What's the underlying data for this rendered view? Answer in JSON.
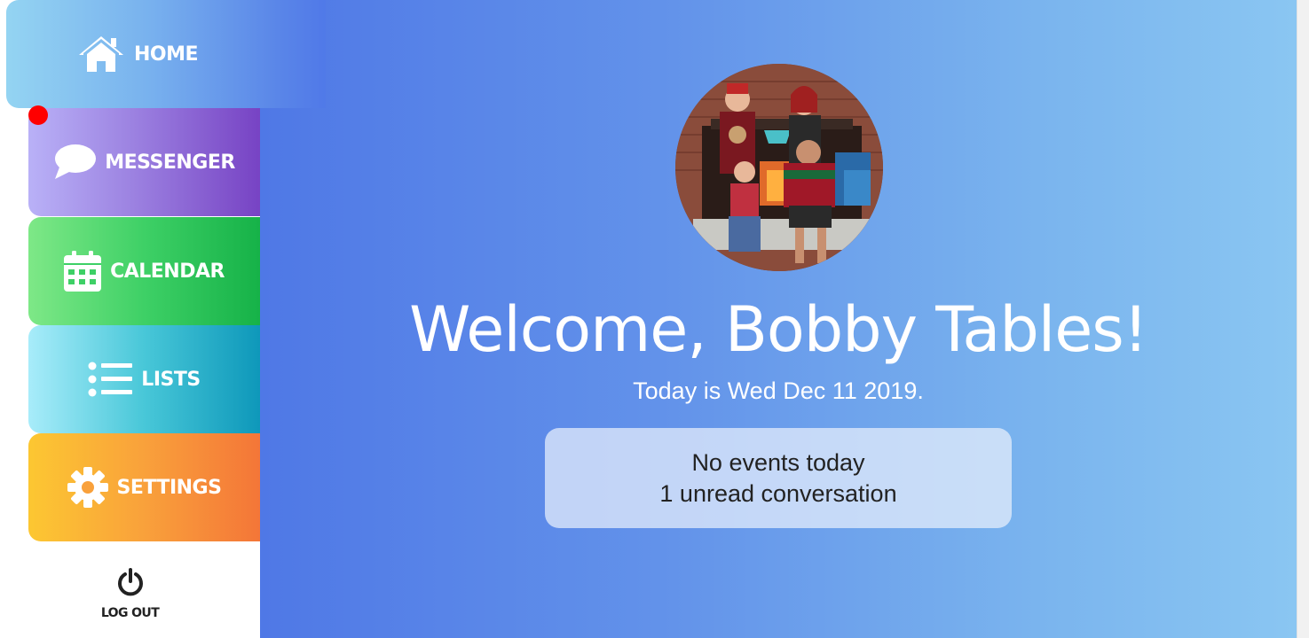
{
  "nav": {
    "home": {
      "label": "HOME",
      "icon": "home-icon"
    },
    "messenger": {
      "label": "MESSENGER",
      "icon": "chat-bubble-icon",
      "has_unread_indicator": true
    },
    "calendar": {
      "label": "CALENDAR",
      "icon": "calendar-icon"
    },
    "lists": {
      "label": "LISTS",
      "icon": "list-icon"
    },
    "settings": {
      "label": "SETTINGS",
      "icon": "gear-icon"
    },
    "logout": {
      "label": "LOG OUT",
      "icon": "power-icon"
    }
  },
  "main": {
    "welcome": "Welcome, Bobby Tables!",
    "date_line": "Today is Wed Dec 11 2019.",
    "summary": {
      "events": "No events today",
      "messages": "1 unread conversation"
    }
  },
  "colors": {
    "unread_dot": "#ff0000",
    "main_gradient_start": "#4f78e6",
    "main_gradient_end": "#8ac6f2"
  }
}
